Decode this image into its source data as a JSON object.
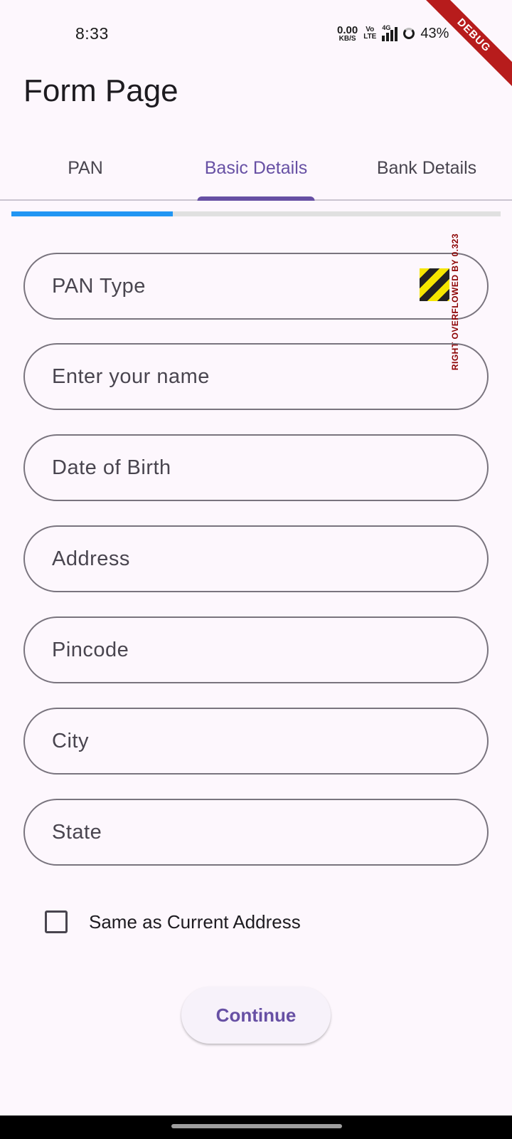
{
  "status_bar": {
    "time": "8:33",
    "net_speed_value": "0.00",
    "net_speed_unit": "KB/S",
    "volte_top": "Vo",
    "volte_bottom": "LTE",
    "network_type": "4G",
    "battery_percent": "43%",
    "icons": [
      "signal-icon",
      "battery-ring-icon"
    ]
  },
  "debug_banner": "DEBUG",
  "app_bar": {
    "title": "Form Page"
  },
  "tabs": [
    {
      "label": "PAN",
      "active": false
    },
    {
      "label": "Basic Details",
      "active": true
    },
    {
      "label": "Bank Details",
      "active": false
    }
  ],
  "progress": {
    "fraction": 0.33,
    "fill_color": "#2196f3",
    "track_color": "#e0e0e0"
  },
  "form": {
    "fields": [
      {
        "placeholder": "PAN Type"
      },
      {
        "placeholder": "Enter your name"
      },
      {
        "placeholder": "Date of Birth"
      },
      {
        "placeholder": "Address"
      },
      {
        "placeholder": "Pincode"
      },
      {
        "placeholder": "City"
      },
      {
        "placeholder": "State"
      }
    ],
    "overflow_warning": "RIGHT OVERFLOWED BY 0.323",
    "checkbox_label": "Same as Current Address",
    "checkbox_checked": false,
    "continue_label": "Continue"
  },
  "colors": {
    "accent": "#6750a4",
    "background": "#fdf7fd",
    "field_border": "#79747e"
  }
}
